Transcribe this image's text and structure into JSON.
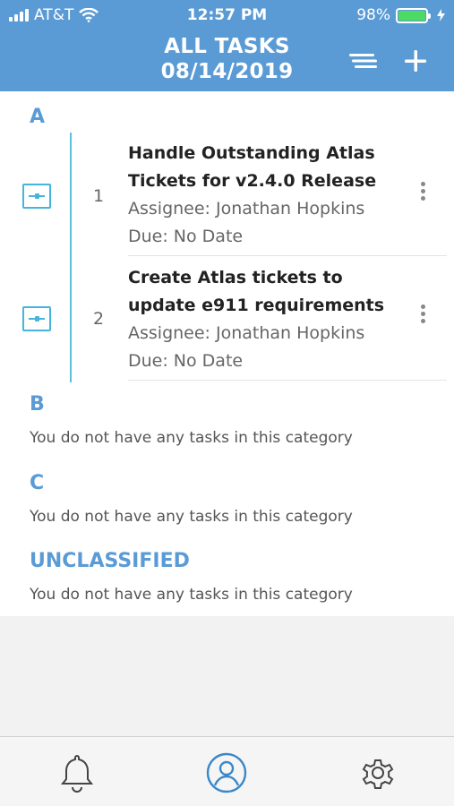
{
  "status_bar": {
    "carrier": "AT&T",
    "time": "12:57 PM",
    "battery": "98%"
  },
  "header": {
    "title": "ALL TASKS",
    "date": "08/14/2019",
    "menu_icon": "sort-lines-icon",
    "add_icon": "plus-icon"
  },
  "sections": [
    {
      "letter": "A",
      "tasks": [
        {
          "number": "1",
          "title_line1": "Handle Outstanding Atlas",
          "title_line2": "Tickets for v2.4.0 Release",
          "assignee": "Assignee: Jonathan Hopkins",
          "due": "Due: No Date"
        },
        {
          "number": "2",
          "title_line1": "Create Atlas tickets to",
          "title_line2": "update e911 requirements",
          "assignee": "Assignee: Jonathan Hopkins",
          "due": "Due: No Date"
        }
      ]
    },
    {
      "letter": "B",
      "empty_message": "You do not have any tasks in this category"
    },
    {
      "letter": "C",
      "empty_message": "You do not have any tasks in this category"
    },
    {
      "letter": "UNCLASSIFIED",
      "empty_message": "You do not have any tasks in this category"
    }
  ],
  "tabbar": {
    "items": [
      "bell-icon",
      "user-profile-icon",
      "gear-icon"
    ]
  },
  "colors": {
    "header_bg": "#5b9bd5",
    "accent": "#5b9bd5",
    "drag_handle": "#45b5dc",
    "battery": "#4cd964"
  }
}
